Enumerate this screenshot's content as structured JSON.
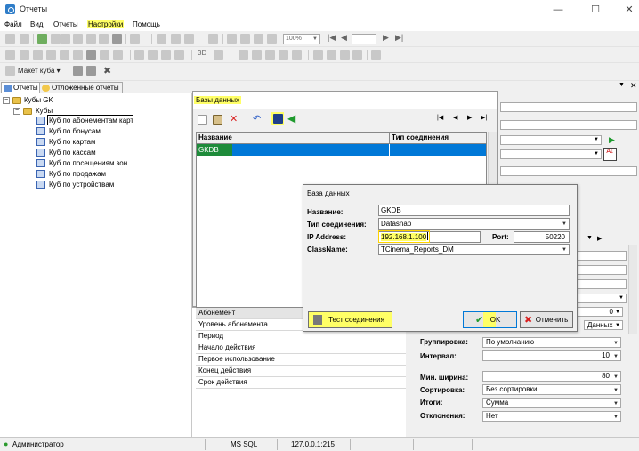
{
  "window": {
    "title": "Отчеты"
  },
  "menu": [
    "Файл",
    "Вид",
    "Отчеты",
    "Настройки",
    "Помощь"
  ],
  "toolbar": {
    "zoom": "100%",
    "cube_layout": "Макет куба",
    "label_3d": "3D"
  },
  "tabs": [
    "Отчеты",
    "Отложенные отчеты"
  ],
  "tree": {
    "root": "Кубы GK",
    "folder": "Кубы",
    "items": [
      "Куб по абонементам карт",
      "Куб по бонусам",
      "Куб по картам",
      "Куб по кассам",
      "Куб по посещениям зон",
      "Куб по продажам",
      "Куб по устройствам"
    ]
  },
  "db_window": {
    "title": "Базы данных",
    "columns": [
      "Название",
      "Тип соединения"
    ],
    "rows": [
      {
        "name": "GKDB",
        "type": ""
      }
    ]
  },
  "dialog": {
    "title": "База данных",
    "name_label": "Название:",
    "name_value": "GKDB",
    "conn_label": "Тип соединения:",
    "conn_value": "Datasnap",
    "ip_label": "IP Address:",
    "ip_value": "192.168.1.100",
    "port_label": "Port:",
    "port_value": "50220",
    "class_label": "ClassName:",
    "class_value": "TCinema_Reports_DM",
    "test_button": "Тест соединения",
    "ok_button": "OK",
    "cancel_button": "Отменить"
  },
  "fields_list": [
    "Абонемент",
    "Уровень абонемента",
    "Период",
    "Начало действия",
    "Первое использование",
    "Конец действия",
    "Срок действия"
  ],
  "props": {
    "grouping_label": "Группировка:",
    "grouping_value": "По умолчанию",
    "interval_label": "Интервал:",
    "interval_value": "10",
    "minwidth_label": "Мин. ширина:",
    "minwidth_value": "80",
    "sort_label": "Сортировка:",
    "sort_value": "Без сортировки",
    "totals_label": "Итоги:",
    "totals_value": "Сумма",
    "dev_label": "Отклонения:",
    "dev_value": "Нет",
    "zero_value": "0",
    "data_value": "Данных"
  },
  "status": {
    "user": "Администратор",
    "db": "MS SQL",
    "host": "127.0.0.1:215"
  },
  "colors": {
    "highlight": "#ffff66",
    "selection": "#0078d7",
    "selection_cell": "#1e8b3a"
  }
}
